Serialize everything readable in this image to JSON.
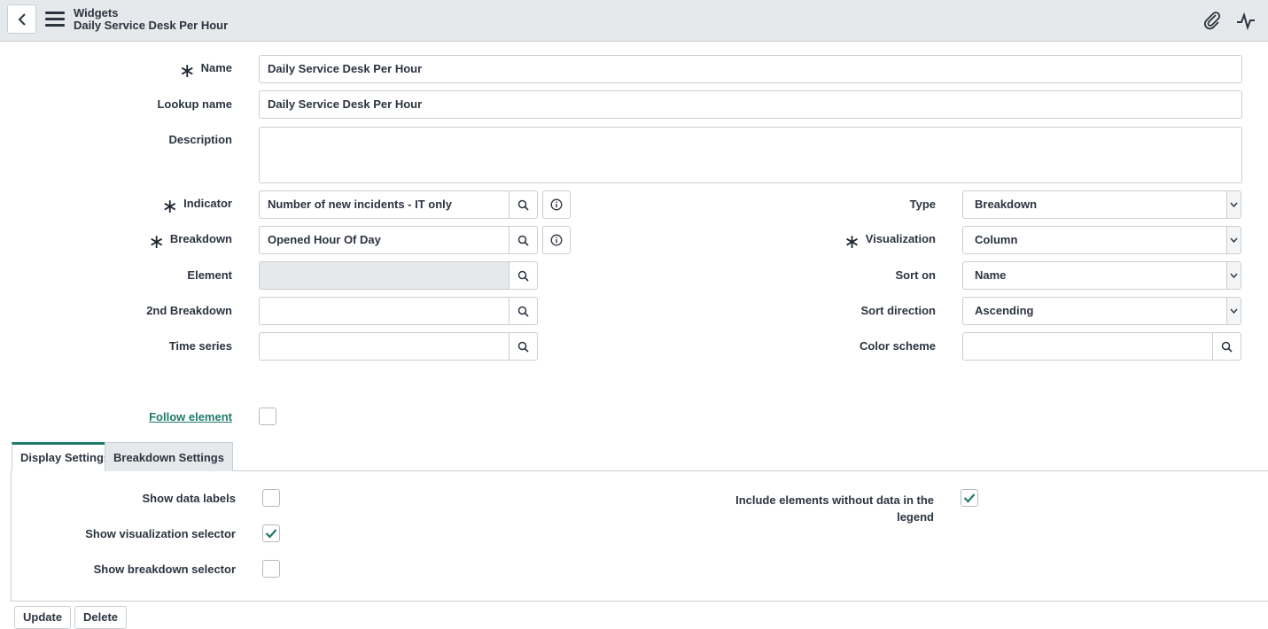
{
  "header": {
    "title": "Widgets",
    "subtitle": "Daily Service Desk Per Hour",
    "icons": [
      "back-icon",
      "menu-icon",
      "paperclip-icon",
      "activity-icon"
    ]
  },
  "form": {
    "name": {
      "label": "Name",
      "required": true,
      "value": "Daily Service Desk Per Hour"
    },
    "lookup_name": {
      "label": "Lookup name",
      "value": "Daily Service Desk Per Hour"
    },
    "description": {
      "label": "Description",
      "value": ""
    },
    "indicator": {
      "label": "Indicator",
      "required": true,
      "value": "Number of new incidents - IT only"
    },
    "breakdown": {
      "label": "Breakdown",
      "required": true,
      "value": "Opened Hour Of Day"
    },
    "element": {
      "label": "Element",
      "value": ""
    },
    "second_breakdown": {
      "label": "2nd Breakdown",
      "value": ""
    },
    "time_series": {
      "label": "Time series",
      "value": ""
    },
    "type": {
      "label": "Type",
      "value": "Breakdown"
    },
    "visualization": {
      "label": "Visualization",
      "required": true,
      "value": "Column"
    },
    "sort_on": {
      "label": "Sort on",
      "value": "Name"
    },
    "sort_direction": {
      "label": "Sort direction",
      "value": "Ascending"
    },
    "color_scheme": {
      "label": "Color scheme",
      "value": ""
    },
    "follow_element": {
      "label": "Follow element",
      "checked": false
    }
  },
  "tabs": [
    {
      "label": "Display Settings",
      "active": true
    },
    {
      "label": "Breakdown Settings",
      "active": false
    }
  ],
  "display_settings": {
    "show_data_labels": {
      "label": "Show data labels",
      "checked": false
    },
    "show_visualization_selector": {
      "label": "Show visualization selector",
      "checked": true
    },
    "show_breakdown_selector": {
      "label": "Show breakdown selector",
      "checked": false
    },
    "include_elements_line1": "Include elements without data in the",
    "include_elements_line2": "legend",
    "include_elements_checked": true
  },
  "buttons": {
    "update": "Update",
    "delete": "Delete"
  },
  "colors": {
    "accent": "#1f7a6c",
    "header_bg": "#e6e9eb",
    "border": "#c9ced2"
  }
}
